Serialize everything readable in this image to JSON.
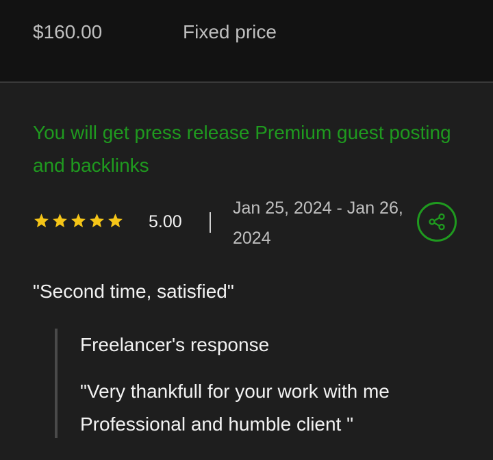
{
  "contract": {
    "price": "$160.00",
    "price_type": "Fixed price"
  },
  "job": {
    "title": "You will get press release Premium guest posting and backlinks"
  },
  "rating": {
    "value": "5.00",
    "stars_filled": 5,
    "stars_total": 5,
    "star_color": "#f5c518"
  },
  "dates": {
    "range": "Jan 25, 2024 - Jan 26, 2024"
  },
  "share": {
    "icon": "share-icon"
  },
  "review": {
    "quote": "\"Second time, satisfied\""
  },
  "freelancer_response": {
    "heading": "Freelancer's response",
    "text": "\"Very thankfull for your work with me Professional and humble client \""
  },
  "colors": {
    "accent_green": "#1f9a1f",
    "background": "#1e1e1e",
    "top_bar": "#121212"
  }
}
